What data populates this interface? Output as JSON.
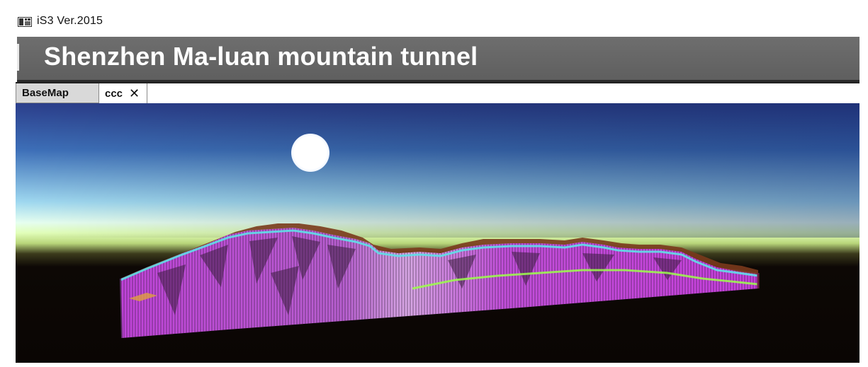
{
  "window": {
    "title": "iS3 Ver.2015",
    "icon": "app-window-icon"
  },
  "banner": {
    "title": "Shenzhen Ma-luan mountain tunnel"
  },
  "tabs": [
    {
      "label": "BaseMap",
      "active": false
    },
    {
      "label": "ccc",
      "active": true,
      "closable": true,
      "close_glyph": "✕"
    }
  ],
  "viewport": {
    "content": "3d-geological-model",
    "colors": {
      "sky_top": "#2a3f8a",
      "sky_horizon": "#eaffc8",
      "ground": "#0c0604",
      "model_fill": "#c64ad8",
      "model_side": "#a23bd0",
      "sun": "#ffffff"
    }
  }
}
